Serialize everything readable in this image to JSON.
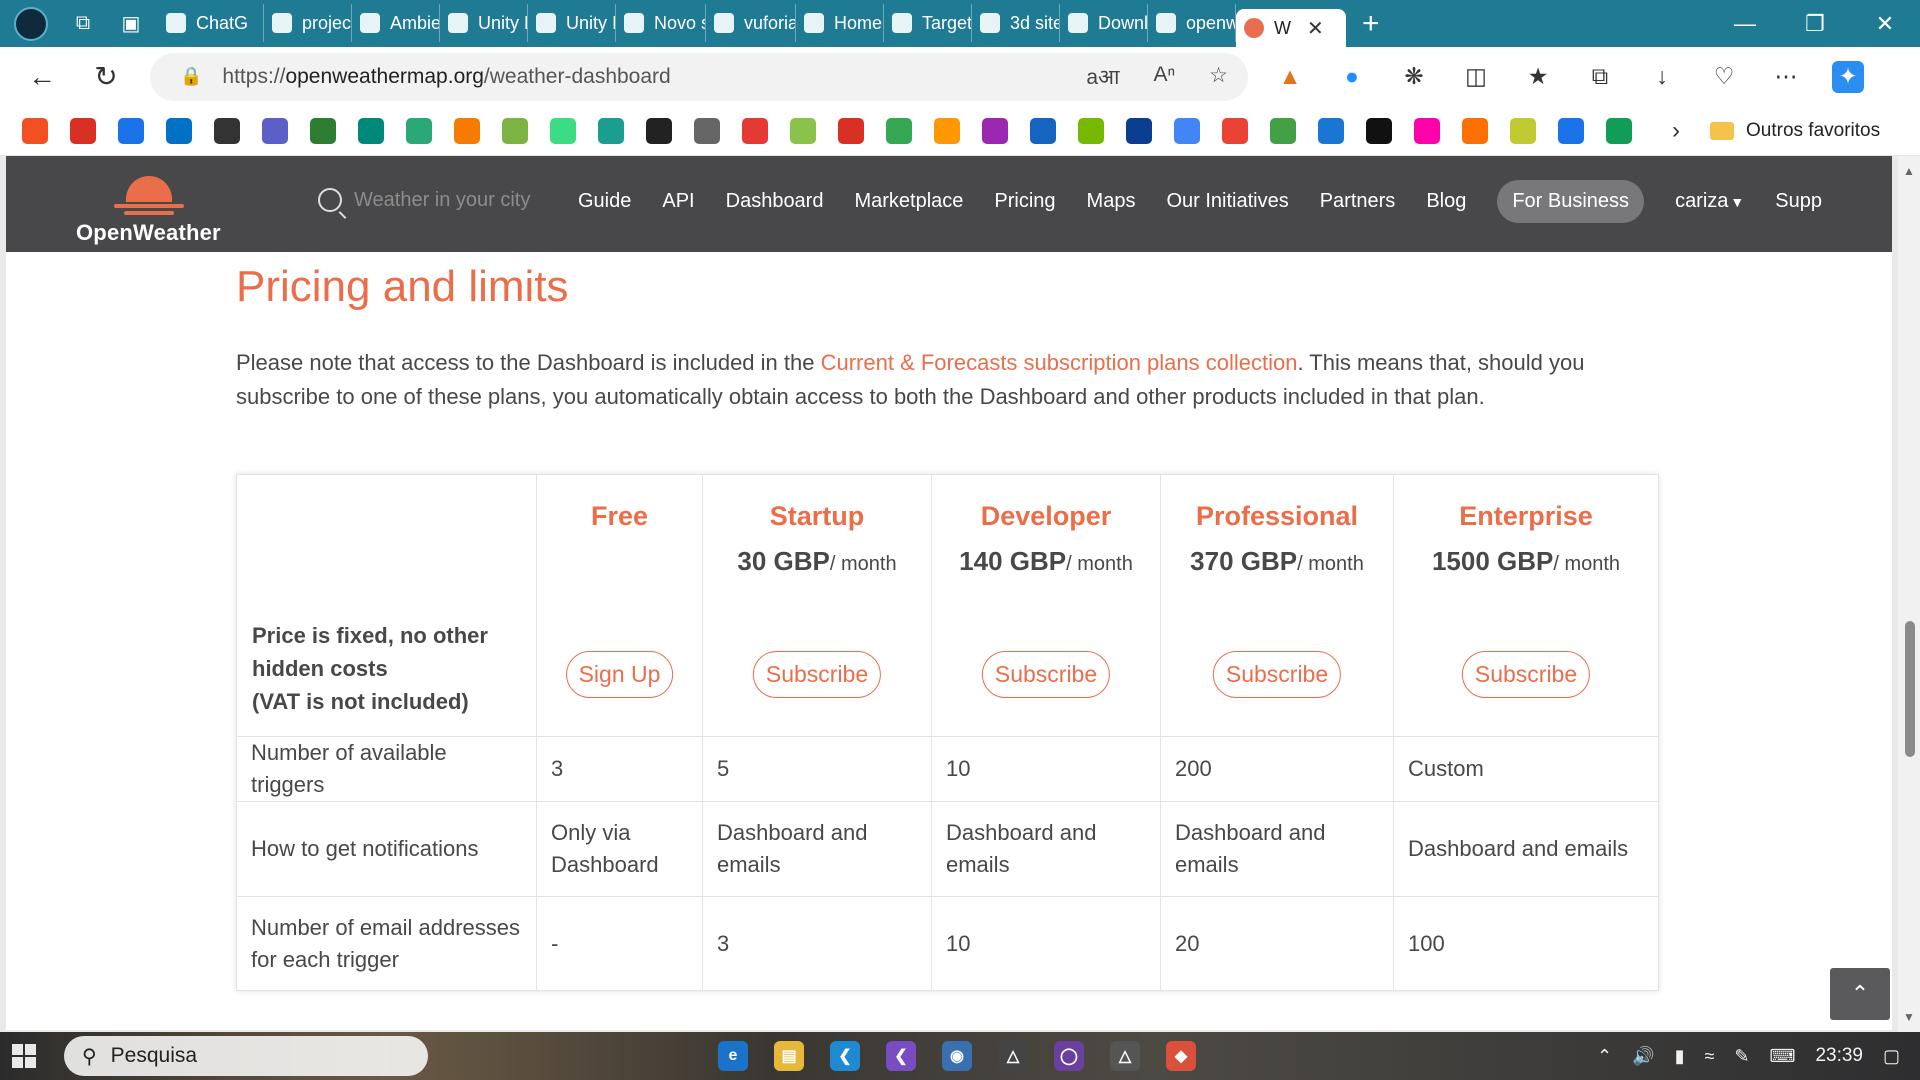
{
  "browser": {
    "tabs": [
      {
        "label": "ChatG",
        "icon": "chatgpt-icon"
      },
      {
        "label": "project",
        "icon": "document-icon"
      },
      {
        "label": "Ambie",
        "icon": "document-icon"
      },
      {
        "label": "Unity F",
        "icon": "document-icon"
      },
      {
        "label": "Unity I",
        "icon": "document-icon"
      },
      {
        "label": "Novo s",
        "icon": "window-icon"
      },
      {
        "label": "vuforia",
        "icon": "search-icon"
      },
      {
        "label": "Home",
        "icon": "vuforia-icon"
      },
      {
        "label": "Target:",
        "icon": "vuforia-icon"
      },
      {
        "label": "3d site",
        "icon": "search-icon"
      },
      {
        "label": "Downl",
        "icon": "cube-icon"
      },
      {
        "label": "openw",
        "icon": "search-icon"
      },
      {
        "label": "W",
        "icon": "openweather-icon",
        "active": true
      }
    ],
    "url_protocol": "https://",
    "url_host": "openweathermap.org",
    "url_path": "/weather-dashboard",
    "favorites_folder": "Outros favoritos",
    "favorites": [
      "windows",
      "gmail",
      "search",
      "intel",
      "app",
      "list",
      "image",
      "puzzle",
      "d",
      "blogger",
      "ring",
      "v",
      "p",
      "OIE",
      "doc",
      "youtube",
      "folder",
      "gmail2",
      "maps",
      "grid",
      "w",
      "16",
      "download",
      "w2",
      "translate",
      "G",
      "check",
      "x",
      "W",
      "circle",
      "color",
      "folder2",
      "search2",
      "edge"
    ]
  },
  "site": {
    "brand": "OpenWeather",
    "search_placeholder": "Weather in your city",
    "nav": {
      "guide": "Guide",
      "api": "API",
      "dashboard": "Dashboard",
      "marketplace": "Marketplace",
      "pricing": "Pricing",
      "maps": "Maps",
      "initiatives": "Our Initiatives",
      "partners": "Partners",
      "blog": "Blog",
      "business": "For Business",
      "user": "cariza",
      "support": "Supp"
    }
  },
  "content": {
    "title": "Pricing and limits",
    "intro_before": "Please note that access to the Dashboard is included in the ",
    "intro_link": "Current & Forecasts subscription plans collection",
    "intro_after": ". This means that, should you subscribe to one of these plans, you automatically obtain access to both the Dashboard and other products included in that plan."
  },
  "table": {
    "header_label_line1": "Price is fixed, no other hidden costs",
    "header_label_line2": "(VAT is not included)",
    "plans": [
      {
        "name": "Free",
        "price": "",
        "per": "",
        "button": "Sign Up"
      },
      {
        "name": "Startup",
        "price": "30 GBP",
        "per": "/ month",
        "button": "Subscribe"
      },
      {
        "name": "Developer",
        "price": "140 GBP",
        "per": "/ month",
        "button": "Subscribe"
      },
      {
        "name": "Professional",
        "price": "370 GBP",
        "per": "/ month",
        "button": "Subscribe"
      },
      {
        "name": "Enterprise",
        "price": "1500 GBP",
        "per": "/ month",
        "button": "Subscribe"
      }
    ],
    "rows": [
      {
        "label": "Number of available triggers",
        "values": [
          "3",
          "5",
          "10",
          "200",
          "Custom"
        ]
      },
      {
        "label": "How to get notifications",
        "values": [
          "Only via Dashboard",
          "Dashboard and emails",
          "Dashboard and emails",
          "Dashboard and emails",
          "Dashboard and emails"
        ]
      },
      {
        "label": "Number of email addresses for each trigger",
        "values": [
          "-",
          "3",
          "10",
          "20",
          "100"
        ]
      }
    ]
  },
  "taskbar": {
    "search_label": "Pesquisa",
    "time": "23:39"
  }
}
